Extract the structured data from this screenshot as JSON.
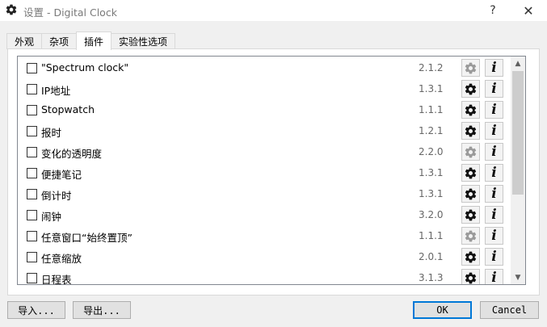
{
  "window": {
    "title": "设置 - Digital Clock",
    "help": "?",
    "close": "✕",
    "icon": "gear-icon"
  },
  "tabs": [
    {
      "label": "外观",
      "active": false
    },
    {
      "label": "杂项",
      "active": false
    },
    {
      "label": "插件",
      "active": true
    },
    {
      "label": "实验性选项",
      "active": false
    }
  ],
  "plugins": [
    {
      "name": "\"Spectrum clock\"",
      "version": "2.1.2",
      "configurable": false,
      "checked": false
    },
    {
      "name": "IP地址",
      "version": "1.3.1",
      "configurable": true,
      "checked": false
    },
    {
      "name": "Stopwatch",
      "version": "1.1.1",
      "configurable": true,
      "checked": false
    },
    {
      "name": "报时",
      "version": "1.2.1",
      "configurable": true,
      "checked": false
    },
    {
      "name": "变化的透明度",
      "version": "2.2.0",
      "configurable": false,
      "checked": false
    },
    {
      "name": "便捷笔记",
      "version": "1.3.1",
      "configurable": true,
      "checked": false
    },
    {
      "name": "倒计时",
      "version": "1.3.1",
      "configurable": true,
      "checked": false
    },
    {
      "name": "闹钟",
      "version": "3.2.0",
      "configurable": true,
      "checked": false
    },
    {
      "name": "任意窗口“始终置顶”",
      "version": "1.1.1",
      "configurable": false,
      "checked": false
    },
    {
      "name": "任意缩放",
      "version": "2.0.1",
      "configurable": true,
      "checked": false
    },
    {
      "name": "日程表",
      "version": "3.1.3",
      "configurable": true,
      "checked": false
    }
  ],
  "info_label": "i",
  "scrollbar": {
    "up": "▲",
    "down": "▼"
  },
  "buttons": {
    "import": "导入...",
    "export": "导出...",
    "ok": "OK",
    "cancel": "Cancel"
  },
  "colors": {
    "gear_enabled": "#111111",
    "gear_disabled": "#9a9a9a",
    "accent": "#0078d7"
  }
}
